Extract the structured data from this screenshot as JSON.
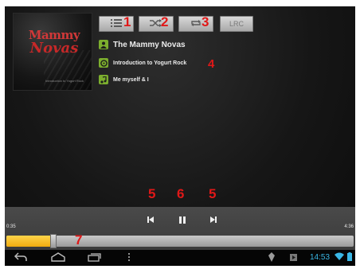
{
  "toolbar": {
    "lrc_label": "LRC",
    "playlist_icon": "playlist-icon",
    "shuffle_icon": "shuffle-icon",
    "repeat_icon": "repeat-icon"
  },
  "album_art": {
    "logo_line1": "Mammy",
    "logo_line2": "Novas",
    "subtitle": "Introduction to Yogurt Rock"
  },
  "track": {
    "artist": "The Mammy Novas",
    "album": "Introduction to Yogurt Rock",
    "song": "Me myself & I"
  },
  "player": {
    "elapsed": "0:35",
    "total": "4:36",
    "progress_fraction": 0.127
  },
  "annotations": {
    "playlist": "1",
    "shuffle": "2",
    "repeat": "3",
    "track_info": "4",
    "prev": "5",
    "pause": "6",
    "next": "5",
    "progress": "7"
  },
  "status_bar": {
    "clock": "14:53"
  },
  "colors": {
    "accent_green": "#7cae2e",
    "progress_yellow": "#f0ac10",
    "annotation_red": "#e01818",
    "status_blue": "#3ab7e6"
  }
}
